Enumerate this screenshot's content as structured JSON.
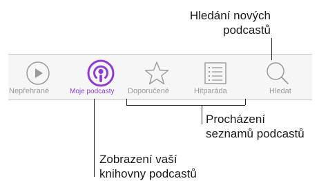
{
  "callouts": {
    "find_new": [
      "Hledání nových",
      "podcastů"
    ],
    "browse": [
      "Procházení",
      "seznamů podcastů"
    ],
    "library": [
      "Zobrazení vaší",
      "knihovny podcastů"
    ]
  },
  "tabbar": {
    "tabs": [
      {
        "id": "unplayed",
        "label": "Nepřehrané",
        "icon": "play-circle-icon",
        "active": false
      },
      {
        "id": "my-podcasts",
        "label": "Moje podcasty",
        "icon": "podcasts-icon",
        "active": true
      },
      {
        "id": "featured",
        "label": "Doporučené",
        "icon": "star-icon",
        "active": false
      },
      {
        "id": "top-charts",
        "label": "Hitparáda",
        "icon": "list-icon",
        "active": false
      },
      {
        "id": "search",
        "label": "Hledat",
        "icon": "search-icon",
        "active": false
      }
    ]
  },
  "colors": {
    "accent": "#8e3bd6",
    "inactive": "#9a9a9a",
    "bar_bg": "#f6f6f6"
  }
}
